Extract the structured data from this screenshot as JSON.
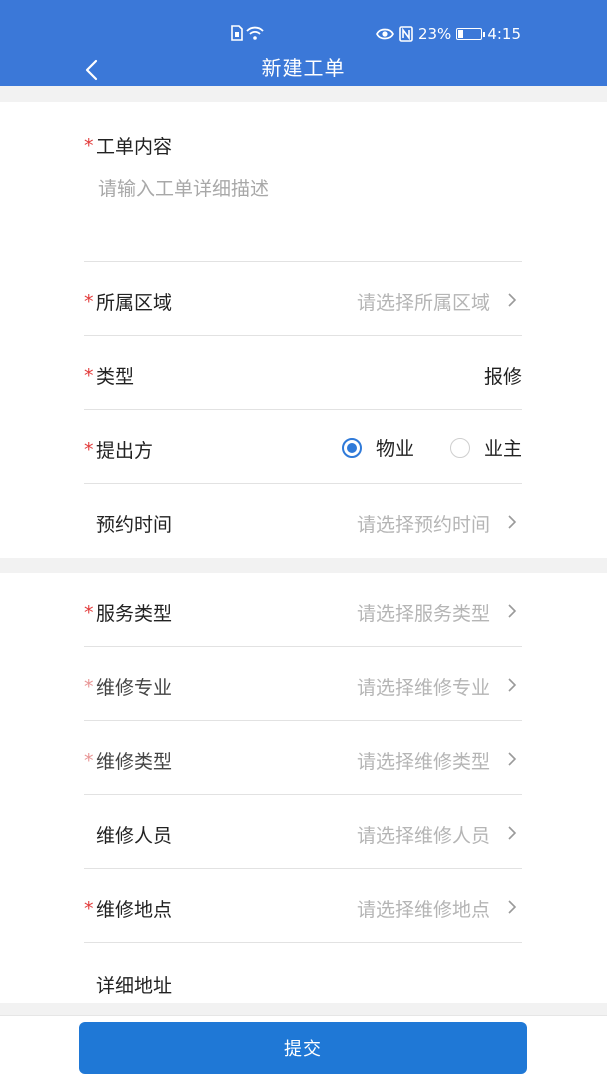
{
  "status_bar": {
    "battery": "23%",
    "time": "4:15",
    "battery_level": 0.23
  },
  "nav": {
    "title": "新建工单"
  },
  "form": {
    "description": {
      "label": "工单内容",
      "placeholder": "请输入工单详细描述"
    },
    "area": {
      "label": "所属区域",
      "placeholder": "请选择所属区域"
    },
    "type": {
      "label": "类型",
      "value": "报修"
    },
    "submitter": {
      "label": "提出方",
      "options": [
        "物业",
        "业主"
      ],
      "selected": "物业"
    },
    "appointment": {
      "label": "预约时间",
      "placeholder": "请选择预约时间"
    },
    "service_type": {
      "label": "服务类型",
      "placeholder": "请选择服务类型"
    },
    "repair_specialty": {
      "label": "维修专业",
      "placeholder": "请选择维修专业"
    },
    "repair_type": {
      "label": "维修类型",
      "placeholder": "请选择维修类型"
    },
    "repair_person": {
      "label": "维修人员",
      "placeholder": "请选择维修人员"
    },
    "repair_location": {
      "label": "维修地点",
      "placeholder": "请选择维修地点"
    },
    "detail_address": {
      "label": "详细地址"
    }
  },
  "footer": {
    "submit_label": "提交"
  },
  "colors": {
    "header": "#3b78d8",
    "required": "#e23b3b",
    "accent": "#1f78d6"
  }
}
